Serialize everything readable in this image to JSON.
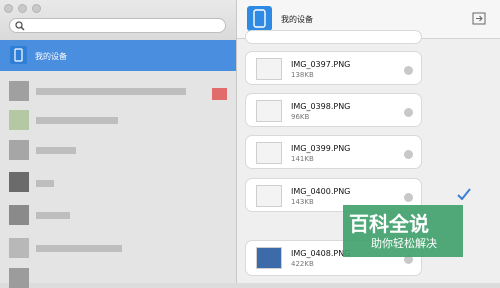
{
  "sidebar": {
    "search": {
      "placeholder": ""
    },
    "selected_item": {
      "label": "我的设备"
    }
  },
  "main": {
    "header": {
      "title": "我的设备"
    },
    "files": [
      {
        "name": "IMG_0397.PNG",
        "size": "138KB"
      },
      {
        "name": "IMG_0398.PNG",
        "size": "96KB"
      },
      {
        "name": "IMG_0399.PNG",
        "size": "141KB"
      },
      {
        "name": "IMG_0400.PNG",
        "size": "143KB"
      },
      {
        "name": "IMG_0408.PNG",
        "size": "422KB"
      }
    ]
  },
  "watermark": {
    "line1": "百科全说",
    "line2": "助你轻松解决"
  },
  "colors": {
    "accent": "#4a8ee0",
    "device_icon": "#2f8ae3"
  }
}
